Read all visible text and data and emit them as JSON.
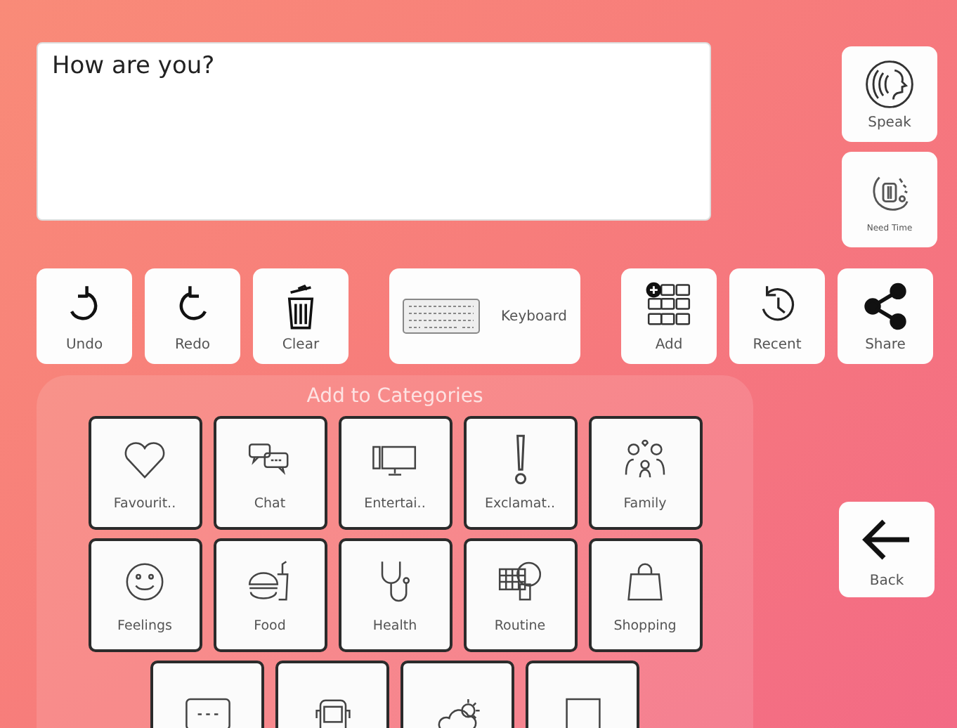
{
  "message": {
    "value": "How are you?"
  },
  "side_buttons": [
    {
      "label": "Speak"
    },
    {
      "label": "Need Time"
    }
  ],
  "toolbar": [
    {
      "label": "Undo"
    },
    {
      "label": "Redo"
    },
    {
      "label": "Clear"
    },
    {
      "label": "Keyboard"
    },
    {
      "label": "Add"
    },
    {
      "label": "Recent"
    },
    {
      "label": "Share"
    }
  ],
  "categories": {
    "title": "Add to Categories",
    "rows": [
      [
        {
          "label": "Favourit.."
        },
        {
          "label": "Chat"
        },
        {
          "label": "Entertai.."
        },
        {
          "label": "Exclamat.."
        },
        {
          "label": "Family"
        }
      ],
      [
        {
          "label": "Feelings"
        },
        {
          "label": "Food"
        },
        {
          "label": "Health"
        },
        {
          "label": "Routine"
        },
        {
          "label": "Shopping"
        }
      ],
      [
        {},
        {},
        {},
        {}
      ]
    ]
  },
  "back": {
    "label": "Back"
  }
}
